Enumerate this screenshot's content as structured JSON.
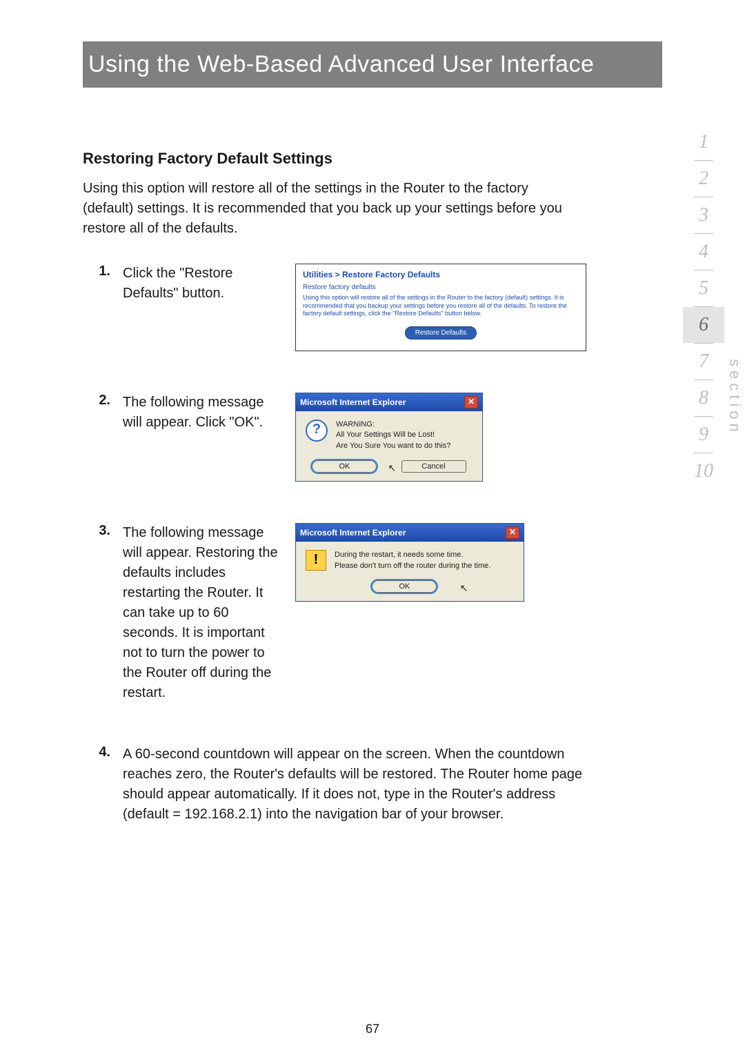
{
  "banner": "Using the Web-Based Advanced User Interface",
  "section_title": "Restoring Factory Default Settings",
  "intro": "Using this option will restore all of the settings in the Router to the factory (default) settings. It is recommended that you back up your settings before you restore all of the defaults.",
  "steps": {
    "s1": {
      "num": "1.",
      "text": "Click the \"Restore Defaults\" button."
    },
    "s2": {
      "num": "2.",
      "text": "The following message will appear. Click \"OK\"."
    },
    "s3": {
      "num": "3.",
      "text": "The following message will appear. Restoring the defaults includes restarting the Router. It can take up to 60 seconds. It is important not to turn the power to the Router off during the restart."
    },
    "s4": {
      "num": "4.",
      "text": "A 60-second countdown will appear on the screen. When the countdown reaches zero, the Router's defaults will be restored. The Router home page should appear automatically. If it does not, type in the Router's address (default = 192.168.2.1) into the navigation bar of your browser."
    }
  },
  "panel1": {
    "crumb": "Utilities > Restore Factory Defaults",
    "sub": "Restore factory defaults",
    "desc": "Using this option will restore all of the settings in the Router to the factory (default) settings. It is recommended that you backup your settings before you restore all of the defaults. To restore the factory default settings, click the \"Restore Defaults\" button below.",
    "button": "Restore Defaults"
  },
  "dialog1": {
    "title": "Microsoft Internet Explorer",
    "close": "✕",
    "line1": "WARNING:",
    "line2": "All Your Settings Will be Lost!",
    "line3": "Are You Sure You want to do this?",
    "ok": "OK",
    "cancel": "Cancel"
  },
  "dialog2": {
    "title": "Microsoft Internet Explorer",
    "close": "✕",
    "line1": "During the restart, it needs some time.",
    "line2": "Please don't turn off the router during the time.",
    "ok": "OK"
  },
  "nav": {
    "items": [
      "1",
      "2",
      "3",
      "4",
      "5",
      "6",
      "7",
      "8",
      "9",
      "10"
    ],
    "active_index": 5,
    "label": "section"
  },
  "page_number": "67"
}
